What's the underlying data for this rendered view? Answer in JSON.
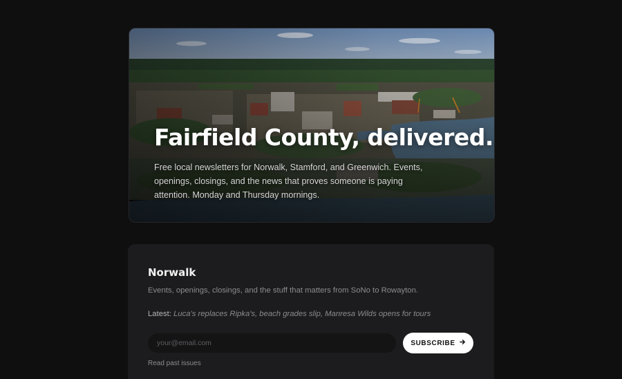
{
  "hero": {
    "title": "Fairfield County, delivered.",
    "description": "Free local newsletters for Norwalk, Stamford, and Greenwich. Events, openings, closings, and the news that proves someone is paying attention. Monday and Thursday mornings."
  },
  "card": {
    "title": "Norwalk",
    "description": "Events, openings, closings, and the stuff that matters from SoNo to Rowayton.",
    "latest_label": "Latest:",
    "latest_text": "Luca's replaces Ripka's, beach grades slip, Manresa Wilds opens for tours",
    "email_placeholder": "your@email.com",
    "email_value": "",
    "subscribe_label": "SUBSCRIBE",
    "subscribe_icon": "arrow-right-icon",
    "past_issues_label": "Read past issues"
  },
  "colors": {
    "background": "#0f0f10",
    "card": "#1c1c1e",
    "button": "#ffffff"
  }
}
